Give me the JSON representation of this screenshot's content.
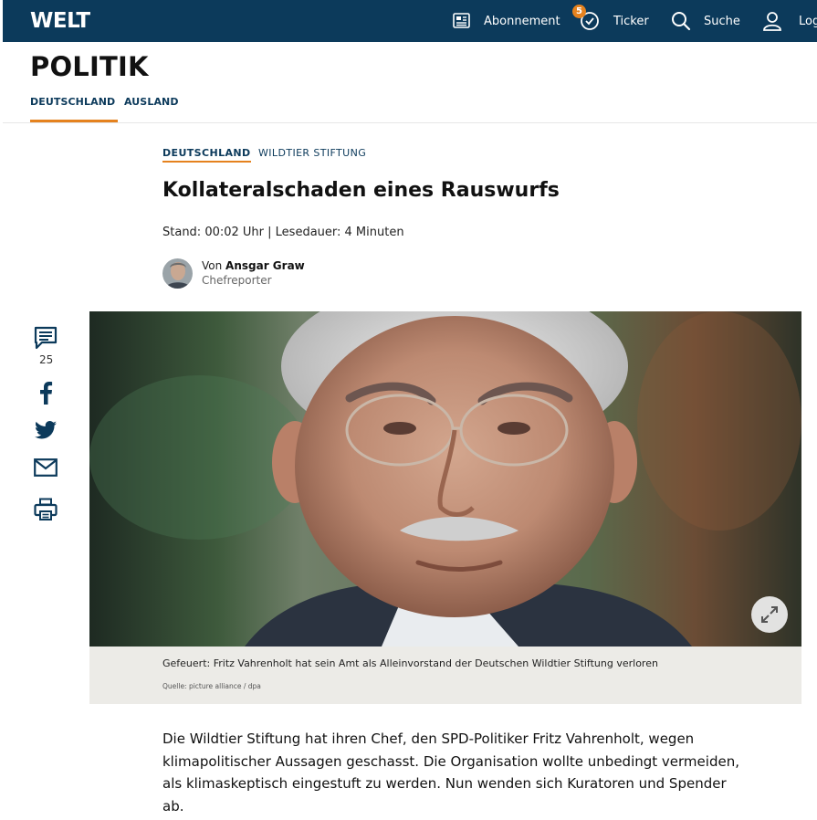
{
  "topnav": {
    "logo": "WELT",
    "abonnement_label": "Abonnement",
    "ticker_label": "Ticker",
    "ticker_badge": "5",
    "search_label": "Suche",
    "login_label": "Log"
  },
  "section": {
    "title": "POLITIK",
    "subnav": [
      "DEUTSCHLAND",
      "AUSLAND"
    ],
    "active_subnav": "DEUTSCHLAND"
  },
  "article": {
    "kicker_primary": "DEUTSCHLAND",
    "kicker_secondary": "WILDTIER STIFTUNG",
    "headline": "Kollateralschaden eines Rauswurfs",
    "stand": "Stand: 00:02 Uhr | Lesedauer: 4 Minuten",
    "author_prefix": "Von ",
    "author_name": "Ansgar Graw",
    "author_role": "Chefreporter",
    "image_caption": "Gefeuert: Fritz Vahrenholt hat sein Amt als Alleinvorstand der Deutschen Wildtier Stiftung verloren",
    "image_source": "Quelle: picture alliance / dpa",
    "lead": "Die Wildtier Stiftung hat ihren Chef, den SPD-Politiker Fritz Vahrenholt, wegen klimapolitischer Aussagen geschasst. Die Organisation wollte unbedingt vermeiden, als klimaskeptisch eingestuft zu werden. Nun wenden sich Kuratoren und Spender ab."
  },
  "share": {
    "comment_count": "25",
    "icons": [
      "comment-icon",
      "facebook-icon",
      "twitter-icon",
      "mail-icon",
      "print-icon"
    ]
  },
  "colors": {
    "brand_blue": "#0c3a5b",
    "accent_orange": "#e5821e",
    "caption_bg": "#ecebe7"
  }
}
